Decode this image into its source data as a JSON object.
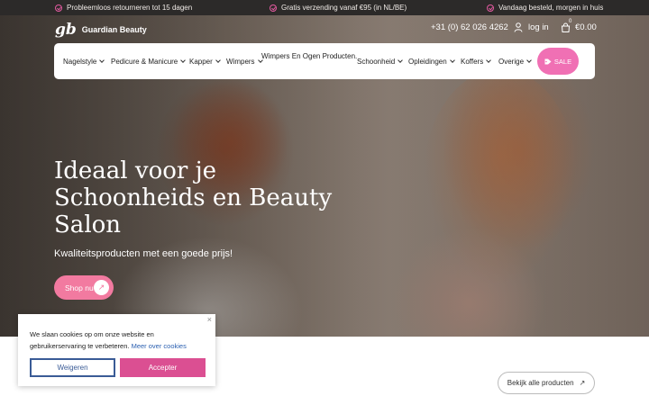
{
  "topbar": {
    "messages": [
      "Probleemloos retourneren tot 15 dagen",
      "Gratis verzending vanaf €95 (in NL/BE)",
      "Vandaag besteld, morgen in huis"
    ]
  },
  "header": {
    "logo_mark": "gb",
    "logo_name": "Guardian Beauty",
    "phone": "+31 (0) 62 026 4262",
    "login_label": "log in",
    "cart_count": "0",
    "cart_total": "€0.00"
  },
  "nav": {
    "items": [
      "Nagelstyle",
      "Pedicure & Manicure",
      "Kapper",
      "Wimpers",
      "Wimpers En Ogen Producten.",
      "Schoonheid",
      "Opleidingen",
      "Koffers",
      "Overige"
    ],
    "sale_label": "SALE"
  },
  "hero": {
    "title": "Ideaal voor je Schoonheids en Beauty Salon",
    "subtitle": "Kwaliteitsproducten met een goede prijs!",
    "cta_label": "Shop nu"
  },
  "products": {
    "view_all_label": "Bekijk alle producten"
  },
  "cookie": {
    "text": "We slaan cookies op om onze website en gebruikerservaring te verbeteren.",
    "link_label": "Meer over cookies",
    "decline_label": "Weigeren",
    "accept_label": "Accepter",
    "close_label": "×"
  },
  "colors": {
    "accent": "#f070b4",
    "cookie_accept": "#db4f92",
    "cookie_decline": "#3a5b96",
    "topbar_bg": "#2c2a29"
  }
}
